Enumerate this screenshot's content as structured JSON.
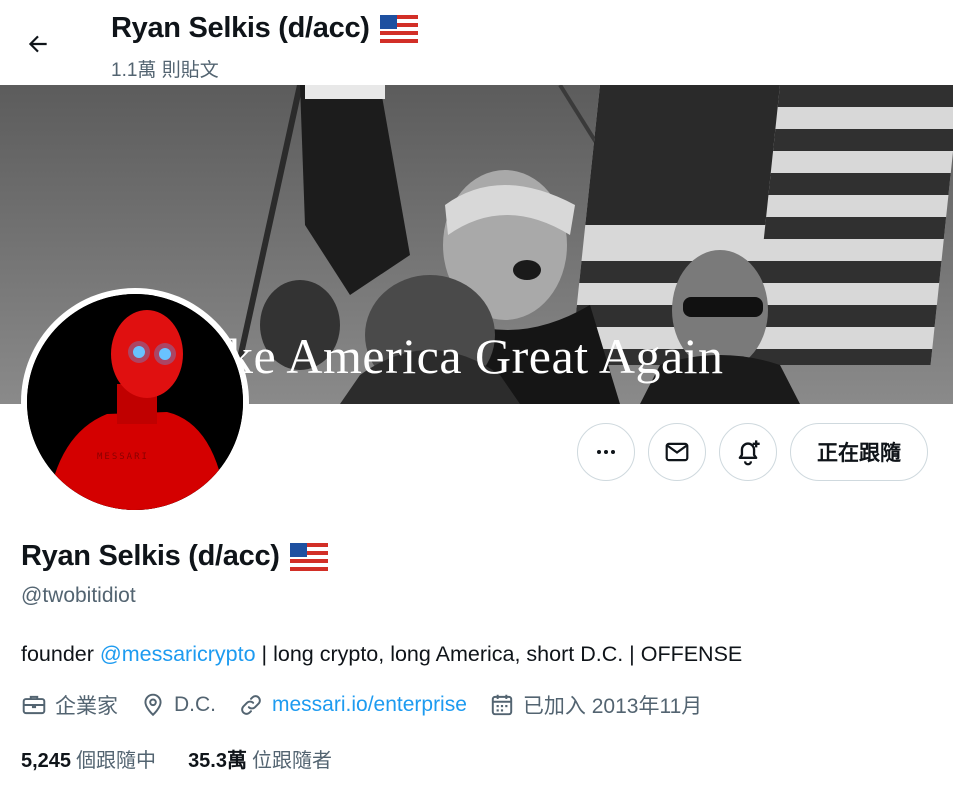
{
  "header": {
    "title": "Ryan Selkis (d/acc)",
    "post_count": "1.1萬 則貼文"
  },
  "banner": {
    "overlay_text": "ke America Great Again"
  },
  "actions": {
    "more_icon": "more-horizontal-icon",
    "message_icon": "envelope-icon",
    "notify_icon": "bell-plus-icon",
    "follow_label": "正在跟隨"
  },
  "profile": {
    "display_name": "Ryan Selkis (d/acc)",
    "handle": "@twobitidiot",
    "bio_prefix": "founder ",
    "bio_mention": "@messaricrypto",
    "bio_suffix": " | long crypto, long America, short D.C. | OFFENSE",
    "avatar_shirt_text": "MESSARI",
    "category": "企業家",
    "location": "D.C.",
    "website": "messari.io/enterprise",
    "joined": "已加入 2013年11月"
  },
  "stats": {
    "following_count": "5,245",
    "following_label": "個跟隨中",
    "followers_count": "35.3萬",
    "followers_label": "位跟隨者"
  },
  "colors": {
    "link": "#1d9bf0",
    "secondary_text": "#536471",
    "primary_text": "#0f1419",
    "border": "#cfd9de"
  }
}
